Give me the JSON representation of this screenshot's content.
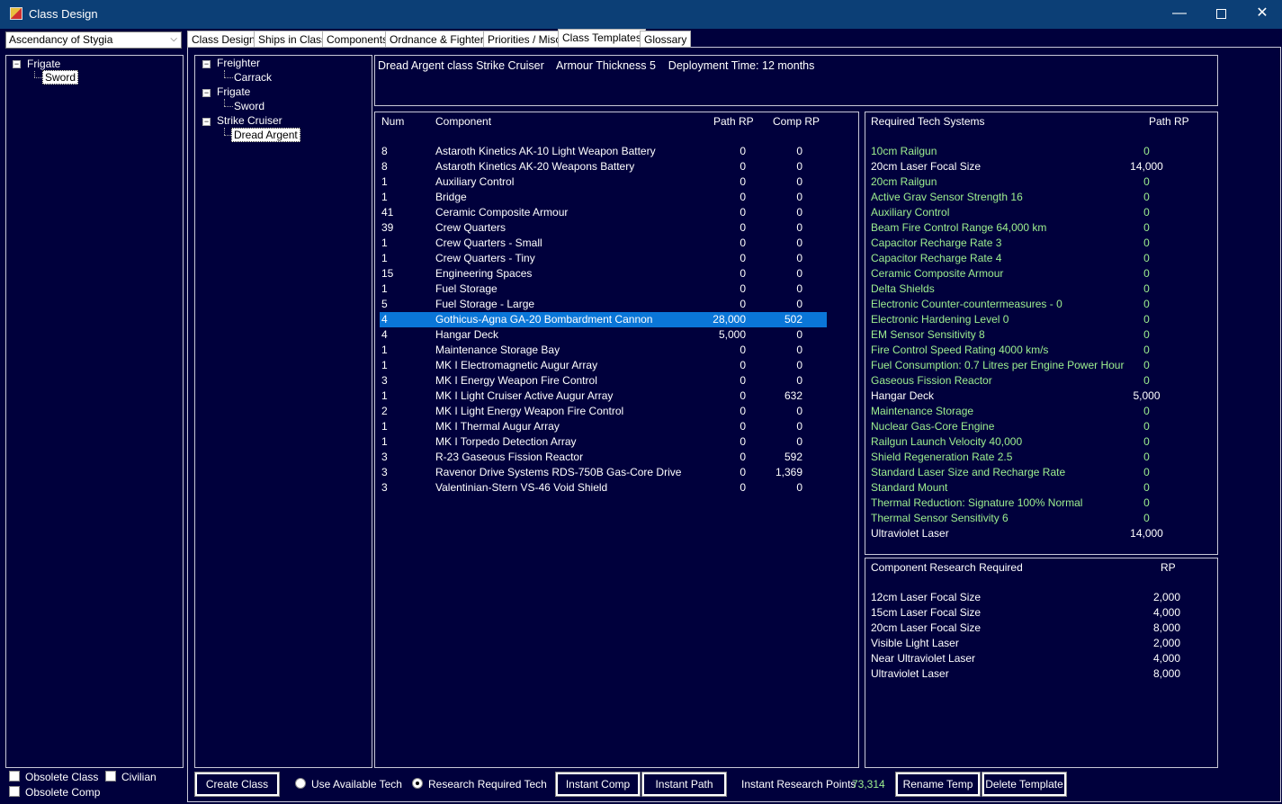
{
  "window": {
    "title": "Class Design",
    "minimize": "—",
    "close": "✕"
  },
  "empire": {
    "selected": "Ascendancy of Stygia"
  },
  "left_tree": {
    "group": "Frigate",
    "item": "Sword"
  },
  "tabs": [
    "Class Design",
    "Ships in Class",
    "Components",
    "Ordnance & Fighters",
    "Priorities / Misc",
    "Class Templates",
    "Glossary"
  ],
  "template_tree": {
    "groups": [
      {
        "label": "Freighter",
        "item": "Carrack"
      },
      {
        "label": "Frigate",
        "item": "Sword"
      },
      {
        "label": "Strike Cruiser",
        "item": "Dread Argent"
      }
    ]
  },
  "summary": {
    "text": "Dread Argent class Strike Cruiser    Armour Thickness 5    Deployment Time: 12 months"
  },
  "components": {
    "headers": {
      "num": "Num",
      "component": "Component",
      "path_rp": "Path RP",
      "comp_rp": "Comp RP"
    },
    "rows": [
      {
        "num": "8",
        "name": "Astaroth Kinetics AK-10 Light Weapon Battery",
        "path": "0",
        "comp": "0"
      },
      {
        "num": "8",
        "name": "Astaroth Kinetics AK-20 Weapons Battery",
        "path": "0",
        "comp": "0"
      },
      {
        "num": "1",
        "name": "Auxiliary Control",
        "path": "0",
        "comp": "0"
      },
      {
        "num": "1",
        "name": "Bridge",
        "path": "0",
        "comp": "0"
      },
      {
        "num": "41",
        "name": "Ceramic Composite Armour",
        "path": "0",
        "comp": "0"
      },
      {
        "num": "39",
        "name": "Crew Quarters",
        "path": "0",
        "comp": "0"
      },
      {
        "num": "1",
        "name": "Crew Quarters - Small",
        "path": "0",
        "comp": "0"
      },
      {
        "num": "1",
        "name": "Crew Quarters - Tiny",
        "path": "0",
        "comp": "0"
      },
      {
        "num": "15",
        "name": "Engineering Spaces",
        "path": "0",
        "comp": "0"
      },
      {
        "num": "1",
        "name": "Fuel Storage",
        "path": "0",
        "comp": "0"
      },
      {
        "num": "5",
        "name": "Fuel Storage - Large",
        "path": "0",
        "comp": "0"
      },
      {
        "num": "4",
        "name": "Gothicus-Agna GA-20 Bombardment Cannon",
        "path": "28,000",
        "comp": "502"
      },
      {
        "num": "4",
        "name": "Hangar Deck",
        "path": "5,000",
        "comp": "0"
      },
      {
        "num": "1",
        "name": "Maintenance Storage Bay",
        "path": "0",
        "comp": "0"
      },
      {
        "num": "1",
        "name": "MK I Electromagnetic Augur Array",
        "path": "0",
        "comp": "0"
      },
      {
        "num": "3",
        "name": "MK I Energy Weapon Fire Control",
        "path": "0",
        "comp": "0"
      },
      {
        "num": "1",
        "name": "MK I Light Cruiser Active Augur Array",
        "path": "0",
        "comp": "632"
      },
      {
        "num": "2",
        "name": "MK I Light Energy Weapon Fire Control",
        "path": "0",
        "comp": "0"
      },
      {
        "num": "1",
        "name": "MK I Thermal Augur Array",
        "path": "0",
        "comp": "0"
      },
      {
        "num": "1",
        "name": "MK I Torpedo Detection Array",
        "path": "0",
        "comp": "0"
      },
      {
        "num": "3",
        "name": "R-23 Gaseous Fission Reactor",
        "path": "0",
        "comp": "592"
      },
      {
        "num": "3",
        "name": "Ravenor Drive Systems RDS-750B Gas-Core Drive",
        "path": "0",
        "comp": "1,369"
      },
      {
        "num": "3",
        "name": "Valentinian-Stern VS-46 Void Shield",
        "path": "0",
        "comp": "0"
      }
    ],
    "selected_index": 11,
    "selected_color": "#0a76d8"
  },
  "required_tech": {
    "headers": {
      "name": "Required Tech Systems",
      "path_rp": "Path RP"
    },
    "rows": [
      {
        "name": "10cm Railgun",
        "rp": "0",
        "researched": true
      },
      {
        "name": "20cm Laser Focal Size",
        "rp": "14,000",
        "researched": false
      },
      {
        "name": "20cm Railgun",
        "rp": "0",
        "researched": true
      },
      {
        "name": "Active Grav Sensor Strength 16",
        "rp": "0",
        "researched": true
      },
      {
        "name": "Auxiliary Control",
        "rp": "0",
        "researched": true
      },
      {
        "name": "Beam Fire Control Range 64,000 km",
        "rp": "0",
        "researched": true
      },
      {
        "name": "Capacitor Recharge Rate 3",
        "rp": "0",
        "researched": true
      },
      {
        "name": "Capacitor Recharge Rate 4",
        "rp": "0",
        "researched": true
      },
      {
        "name": "Ceramic Composite Armour",
        "rp": "0",
        "researched": true
      },
      {
        "name": "Delta Shields",
        "rp": "0",
        "researched": true
      },
      {
        "name": "Electronic Counter-countermeasures - 0",
        "rp": "0",
        "researched": true
      },
      {
        "name": "Electronic Hardening Level 0",
        "rp": "0",
        "researched": true
      },
      {
        "name": "EM Sensor Sensitivity 8",
        "rp": "0",
        "researched": true
      },
      {
        "name": "Fire Control Speed Rating 4000 km/s",
        "rp": "0",
        "researched": true
      },
      {
        "name": "Fuel Consumption: 0.7 Litres per Engine Power Hour",
        "rp": "0",
        "researched": true
      },
      {
        "name": "Gaseous Fission Reactor",
        "rp": "0",
        "researched": true
      },
      {
        "name": "Hangar Deck",
        "rp": "5,000",
        "researched": false
      },
      {
        "name": "Maintenance Storage",
        "rp": "0",
        "researched": true
      },
      {
        "name": "Nuclear Gas-Core Engine",
        "rp": "0",
        "researched": true
      },
      {
        "name": "Railgun Launch Velocity 40,000",
        "rp": "0",
        "researched": true
      },
      {
        "name": "Shield Regeneration Rate 2.5",
        "rp": "0",
        "researched": true
      },
      {
        "name": "Standard Laser Size and Recharge Rate",
        "rp": "0",
        "researched": true
      },
      {
        "name": "Standard Mount",
        "rp": "0",
        "researched": true
      },
      {
        "name": "Thermal Reduction: Signature 100% Normal",
        "rp": "0",
        "researched": true
      },
      {
        "name": "Thermal Sensor Sensitivity 6",
        "rp": "0",
        "researched": true
      },
      {
        "name": "Ultraviolet Laser",
        "rp": "14,000",
        "researched": false
      }
    ],
    "researched_color": "#9ef08f"
  },
  "component_research": {
    "headers": {
      "name": "Component Research Required",
      "rp": "RP"
    },
    "rows": [
      {
        "name": "12cm Laser Focal Size",
        "rp": "2,000"
      },
      {
        "name": "15cm Laser Focal Size",
        "rp": "4,000"
      },
      {
        "name": "20cm Laser Focal Size",
        "rp": "8,000"
      },
      {
        "name": "Visible Light Laser",
        "rp": "2,000"
      },
      {
        "name": "Near Ultraviolet Laser",
        "rp": "4,000"
      },
      {
        "name": "Ultraviolet Laser",
        "rp": "8,000"
      }
    ]
  },
  "bottom_left": {
    "obsolete_class": "Obsolete Class",
    "civilian": "Civilian",
    "obsolete_comp": "Obsolete Comp"
  },
  "bottom_bar": {
    "create_class": "Create Class",
    "use_available_tech": "Use Available Tech",
    "research_required_tech": "Research Required Tech",
    "instant_comp": "Instant Comp",
    "instant_path": "Instant Path",
    "instant_research_label": "Instant Research Points",
    "instant_research_value": "73,314",
    "rename_temp": "Rename Temp",
    "delete_template": "Delete Template"
  }
}
